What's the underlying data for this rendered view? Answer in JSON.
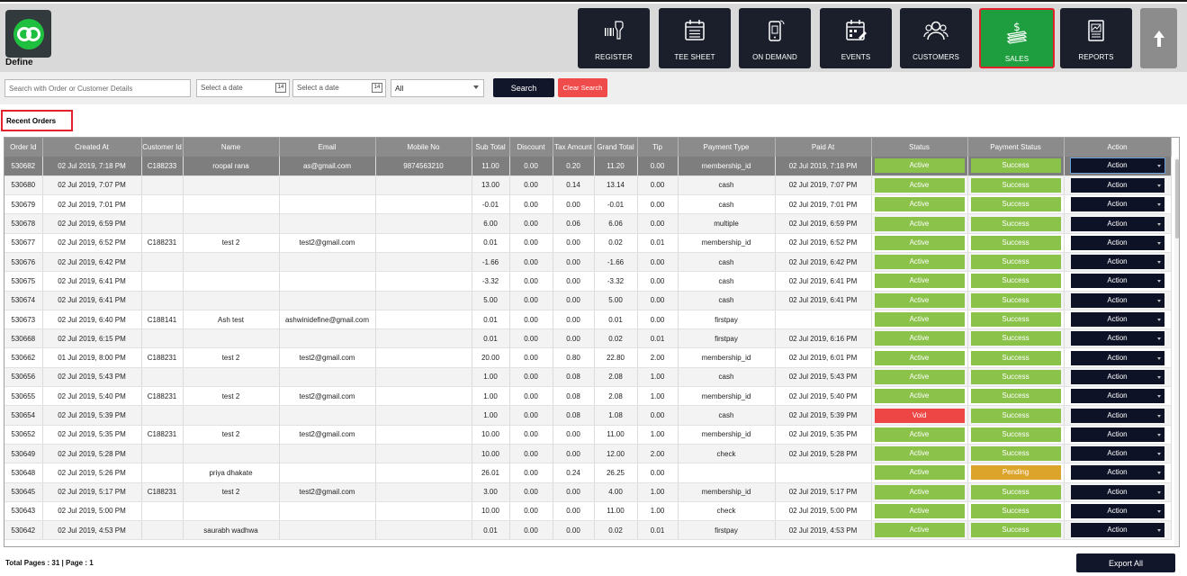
{
  "app": {
    "logo_text": "Define"
  },
  "nav": [
    {
      "label": "REGISTER",
      "icon": "barcode-scanner-icon"
    },
    {
      "label": "TEE SHEET",
      "icon": "calendar-list-icon"
    },
    {
      "label": "ON DEMAND",
      "icon": "mobile-icon"
    },
    {
      "label": "EVENTS",
      "icon": "event-calendar-icon"
    },
    {
      "label": "CUSTOMERS",
      "icon": "users-icon"
    },
    {
      "label": "SALES",
      "icon": "money-icon",
      "active": true
    },
    {
      "label": "REPORTS",
      "icon": "report-icon"
    }
  ],
  "filters": {
    "search_placeholder": "Search with Order or Customer Details",
    "date_from_placeholder": "Select a date",
    "date_to_placeholder": "Select a date",
    "calendar_day": "14",
    "status_value": "All",
    "search_label": "Search",
    "clear_label": "Clear Search"
  },
  "section_title": "Recent Orders",
  "table": {
    "columns": [
      "Order Id",
      "Created At",
      "Customer Id",
      "Name",
      "Email",
      "Mobile No",
      "Sub Total",
      "Discount",
      "Tax Amount",
      "Grand Total",
      "Tip",
      "Payment Type",
      "Paid At",
      "Status",
      "Payment Status",
      "Action"
    ],
    "rows": [
      [
        "530682",
        "02 Jul 2019, 7:18 PM",
        "C188233",
        "roopal rana",
        "as@gmail.com",
        "9874563210",
        "11.00",
        "0.00",
        "0.20",
        "11.20",
        "0.00",
        "membership_id",
        "02 Jul 2019, 7:18 PM",
        "Active",
        "Success",
        "Action"
      ],
      [
        "530680",
        "02 Jul 2019, 7:07 PM",
        "",
        "",
        "",
        "",
        "13.00",
        "0.00",
        "0.14",
        "13.14",
        "0.00",
        "cash",
        "02 Jul 2019, 7:07 PM",
        "Active",
        "Success",
        "Action"
      ],
      [
        "530679",
        "02 Jul 2019, 7:01 PM",
        "",
        "",
        "",
        "",
        "-0.01",
        "0.00",
        "0.00",
        "-0.01",
        "0.00",
        "cash",
        "02 Jul 2019, 7:01 PM",
        "Active",
        "Success",
        "Action"
      ],
      [
        "530678",
        "02 Jul 2019, 6:59 PM",
        "",
        "",
        "",
        "",
        "6.00",
        "0.00",
        "0.06",
        "6.06",
        "0.00",
        "multiple",
        "02 Jul 2019, 6:59 PM",
        "Active",
        "Success",
        "Action"
      ],
      [
        "530677",
        "02 Jul 2019, 6:52 PM",
        "C188231",
        "test 2",
        "test2@gmail.com",
        "",
        "0.01",
        "0.00",
        "0.00",
        "0.02",
        "0.01",
        "membership_id",
        "02 Jul 2019, 6:52 PM",
        "Active",
        "Success",
        "Action"
      ],
      [
        "530676",
        "02 Jul 2019, 6:42 PM",
        "",
        "",
        "",
        "",
        "-1.66",
        "0.00",
        "0.00",
        "-1.66",
        "0.00",
        "cash",
        "02 Jul 2019, 6:42 PM",
        "Active",
        "Success",
        "Action"
      ],
      [
        "530675",
        "02 Jul 2019, 6:41 PM",
        "",
        "",
        "",
        "",
        "-3.32",
        "0.00",
        "0.00",
        "-3.32",
        "0.00",
        "cash",
        "02 Jul 2019, 6:41 PM",
        "Active",
        "Success",
        "Action"
      ],
      [
        "530674",
        "02 Jul 2019, 6:41 PM",
        "",
        "",
        "",
        "",
        "5.00",
        "0.00",
        "0.00",
        "5.00",
        "0.00",
        "cash",
        "02 Jul 2019, 6:41 PM",
        "Active",
        "Success",
        "Action"
      ],
      [
        "530673",
        "02 Jul 2019, 6:40 PM",
        "C188141",
        "Ash test",
        "ashwinidefine@gmail.com",
        "",
        "0.01",
        "0.00",
        "0.00",
        "0.01",
        "0.00",
        "firstpay",
        "",
        "Active",
        "Success",
        "Action"
      ],
      [
        "530668",
        "02 Jul 2019, 6:15 PM",
        "",
        "",
        "",
        "",
        "0.01",
        "0.00",
        "0.00",
        "0.02",
        "0.01",
        "firstpay",
        "02 Jul 2019, 6:16 PM",
        "Active",
        "Success",
        "Action"
      ],
      [
        "530662",
        "01 Jul 2019, 8:00 PM",
        "C188231",
        "test 2",
        "test2@gmail.com",
        "",
        "20.00",
        "0.00",
        "0.80",
        "22.80",
        "2.00",
        "membership_id",
        "02 Jul 2019, 6:01 PM",
        "Active",
        "Success",
        "Action"
      ],
      [
        "530656",
        "02 Jul 2019, 5:43 PM",
        "",
        "",
        "",
        "",
        "1.00",
        "0.00",
        "0.08",
        "2.08",
        "1.00",
        "cash",
        "02 Jul 2019, 5:43 PM",
        "Active",
        "Success",
        "Action"
      ],
      [
        "530655",
        "02 Jul 2019, 5:40 PM",
        "C188231",
        "test 2",
        "test2@gmail.com",
        "",
        "1.00",
        "0.00",
        "0.08",
        "2.08",
        "1.00",
        "membership_id",
        "02 Jul 2019, 5:40 PM",
        "Active",
        "Success",
        "Action"
      ],
      [
        "530654",
        "02 Jul 2019, 5:39 PM",
        "",
        "",
        "",
        "",
        "1.00",
        "0.00",
        "0.08",
        "1.08",
        "0.00",
        "cash",
        "02 Jul 2019, 5:39 PM",
        "Void",
        "Success",
        "Action"
      ],
      [
        "530652",
        "02 Jul 2019, 5:35 PM",
        "C188231",
        "test 2",
        "test2@gmail.com",
        "",
        "10.00",
        "0.00",
        "0.00",
        "11.00",
        "1.00",
        "membership_id",
        "02 Jul 2019, 5:35 PM",
        "Active",
        "Success",
        "Action"
      ],
      [
        "530649",
        "02 Jul 2019, 5:28 PM",
        "",
        "",
        "",
        "",
        "10.00",
        "0.00",
        "0.00",
        "12.00",
        "2.00",
        "check",
        "02 Jul 2019, 5:28 PM",
        "Active",
        "Success",
        "Action"
      ],
      [
        "530648",
        "02 Jul 2019, 5:26 PM",
        "",
        "priya dhakate",
        "",
        "",
        "26.01",
        "0.00",
        "0.24",
        "26.25",
        "0.00",
        "",
        "",
        "Active",
        "Pending",
        "Action"
      ],
      [
        "530645",
        "02 Jul 2019, 5:17 PM",
        "C188231",
        "test 2",
        "test2@gmail.com",
        "",
        "3.00",
        "0.00",
        "0.00",
        "4.00",
        "1.00",
        "membership_id",
        "02 Jul 2019, 5:17 PM",
        "Active",
        "Success",
        "Action"
      ],
      [
        "530643",
        "02 Jul 2019, 5:00 PM",
        "",
        "",
        "",
        "",
        "10.00",
        "0.00",
        "0.00",
        "11.00",
        "1.00",
        "check",
        "02 Jul 2019, 5:00 PM",
        "Active",
        "Success",
        "Action"
      ],
      [
        "530642",
        "02 Jul 2019, 4:53 PM",
        "",
        "saurabh wadhwa",
        "",
        "",
        "0.01",
        "0.00",
        "0.00",
        "0.02",
        "0.01",
        "firstpay",
        "02 Jul 2019, 4:53 PM",
        "Active",
        "Success",
        "Action"
      ]
    ]
  },
  "footer": {
    "pages_text": "Total Pages : 31 | Page : 1",
    "export_label": "Export All"
  },
  "colors": {
    "nav_bg": "#1a1f2b",
    "active_nav": "#1e9e3e",
    "highlight_border": "#e3232b",
    "status_active": "#8bc24a",
    "status_void": "#ee4545",
    "status_pending": "#dca42a",
    "action_bg": "#0d1226"
  }
}
